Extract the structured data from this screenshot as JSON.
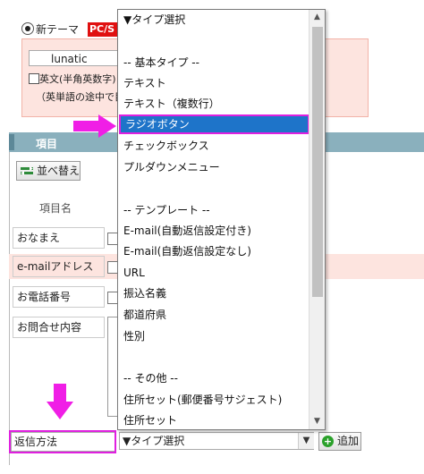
{
  "theme": {
    "radio_label": "新テーマ",
    "badge": "PC/S"
  },
  "font_settings": {
    "font_value": "lunatic",
    "halfwidth_label": "英文(半角英数字)",
    "halfwidth_note": "（英単語の途中で目"
  },
  "items_panel": {
    "title": "項目",
    "sort_button": "並べ替え",
    "column_header": "項目名",
    "rows": [
      {
        "label": "おなまえ"
      },
      {
        "label": "e-mailアドレス"
      },
      {
        "label": "お電話番号"
      },
      {
        "label": "お問合せ内容"
      }
    ]
  },
  "new_field": {
    "name_value": "返信方法",
    "type_select_value": "▼タイプ選択",
    "add_button": "追加"
  },
  "dropdown": {
    "items": [
      {
        "label": "▼タイプ選択"
      },
      {
        "label": ""
      },
      {
        "label": "-- 基本タイプ --"
      },
      {
        "label": "テキスト"
      },
      {
        "label": "テキスト（複数行）"
      },
      {
        "label": "ラジオボタン"
      },
      {
        "label": "チェックボックス"
      },
      {
        "label": "プルダウンメニュー"
      },
      {
        "label": ""
      },
      {
        "label": "-- テンプレート --"
      },
      {
        "label": "E-mail(自動返信設定付き)"
      },
      {
        "label": "E-mail(自動返信設定なし)"
      },
      {
        "label": "URL"
      },
      {
        "label": "振込名義"
      },
      {
        "label": "都道府県"
      },
      {
        "label": "性別"
      },
      {
        "label": ""
      },
      {
        "label": "-- その他 --"
      },
      {
        "label": "住所セット(郵便番号サジェスト)"
      },
      {
        "label": "住所セット"
      }
    ],
    "selected_index": 5
  },
  "colors": {
    "highlight": "#e020e0",
    "selected_bg": "#1e74c9",
    "header_bar": "#8ab0bd",
    "pink_bg": "#fde4df",
    "badge_red": "#e01010"
  }
}
